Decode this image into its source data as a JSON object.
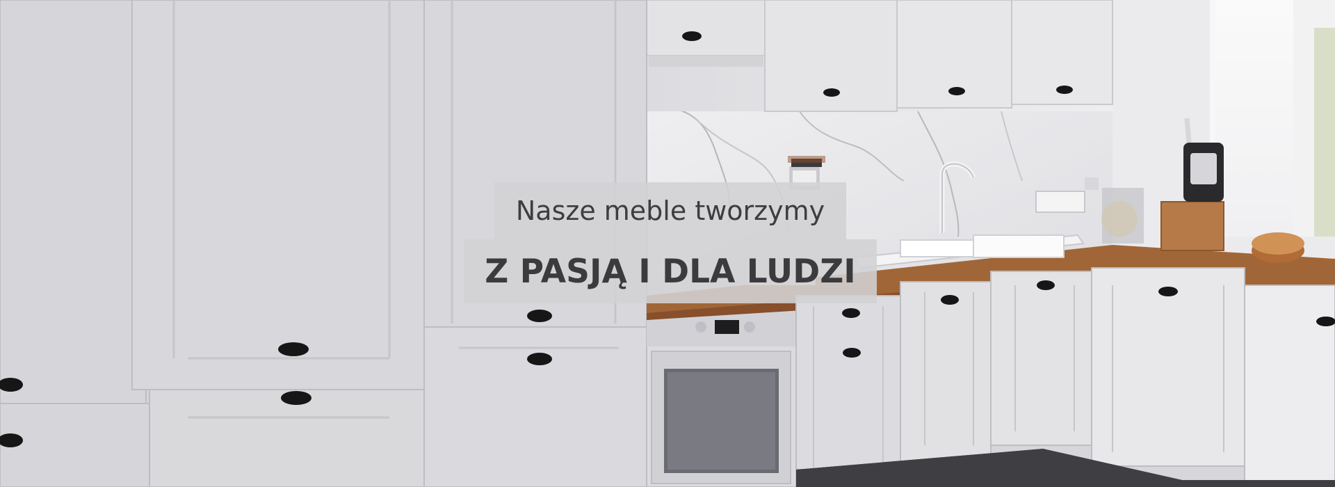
{
  "hero": {
    "headline": "Nasze meble tworzymy",
    "tagline": "Z PASJĄ I DLA LUDZI"
  },
  "colors": {
    "cabinet": "#dcdce0",
    "cabinet_edge": "#c8c8cc",
    "worktop": "#a16637",
    "backsplash": "#e8e8ea",
    "overlay": "#d2d2d4",
    "text": "#3d3d3f"
  }
}
